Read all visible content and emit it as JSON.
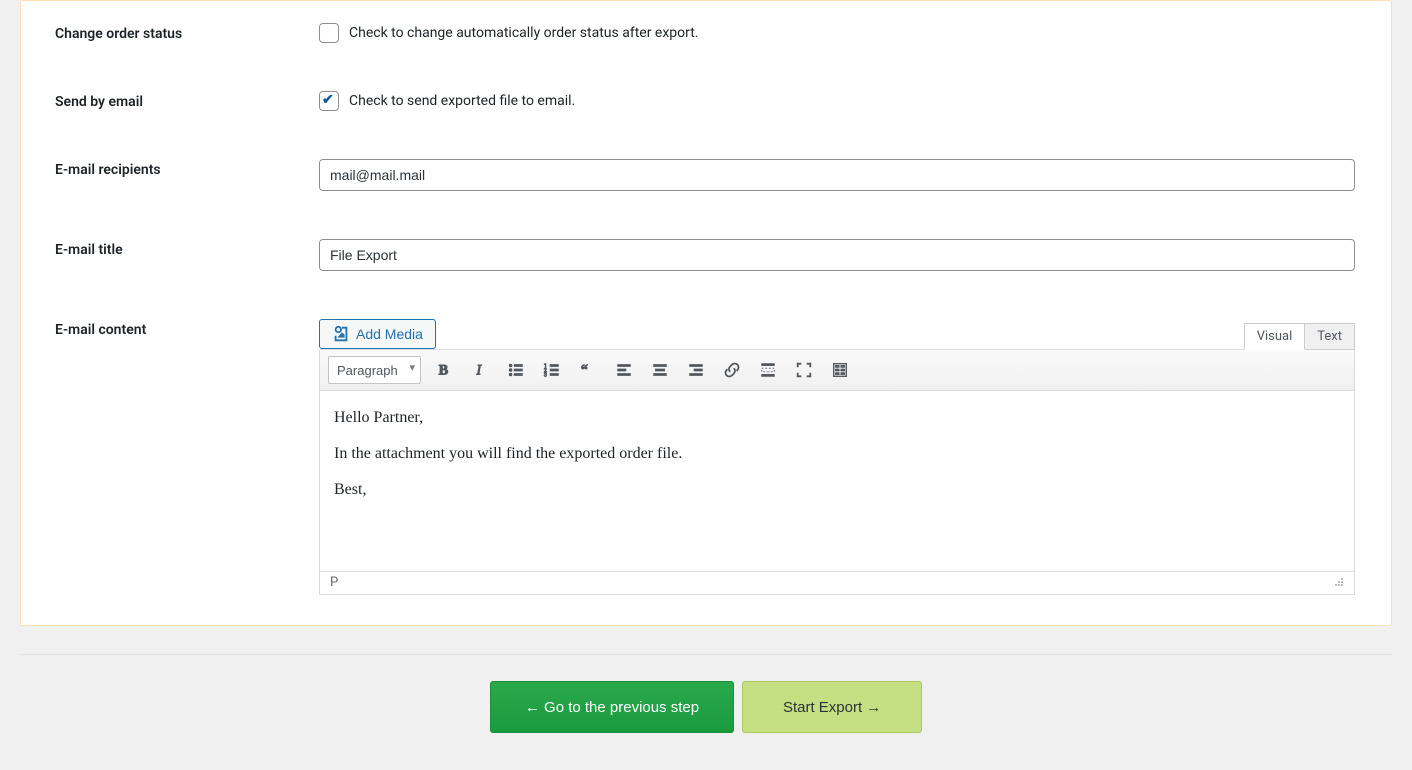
{
  "form": {
    "change_status": {
      "label": "Change order status",
      "checkbox_text": "Check to change automatically order status after export.",
      "checked": false
    },
    "send_email": {
      "label": "Send by email",
      "checkbox_text": "Check to send exported file to email.",
      "checked": true
    },
    "recipients": {
      "label": "E-mail recipients",
      "value": "mail@mail.mail"
    },
    "title": {
      "label": "E-mail title",
      "value": "File Export"
    },
    "content": {
      "label": "E-mail content",
      "add_media": "Add Media",
      "tab_visual": "Visual",
      "tab_text": "Text",
      "format_select": "Paragraph",
      "body": {
        "p1": "Hello Partner,",
        "p2": "In the attachment you will find the exported order file.",
        "p3": "Best,"
      },
      "status_path": "P"
    }
  },
  "actions": {
    "prev": "← Go to the previous step",
    "start": "Start Export →"
  }
}
